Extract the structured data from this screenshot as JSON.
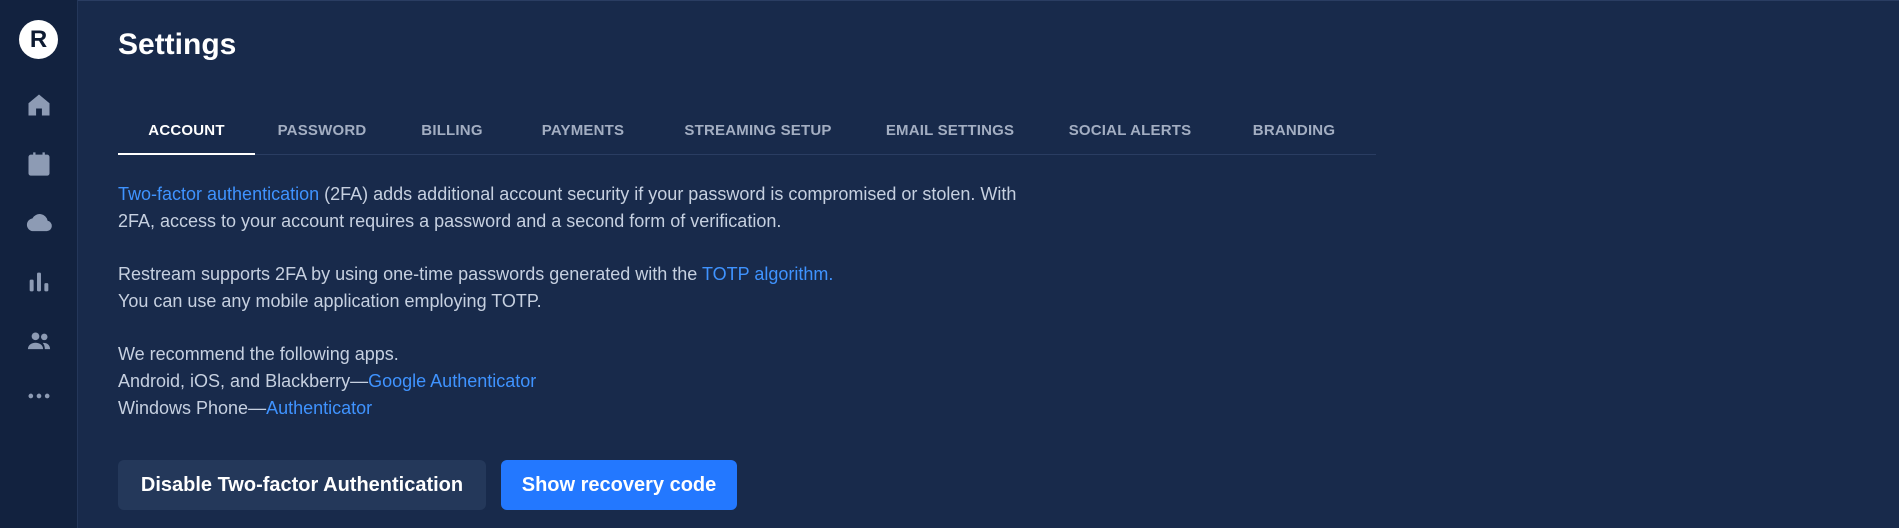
{
  "sidebar": {
    "logo_letter": "R",
    "items": [
      {
        "name": "home-icon"
      },
      {
        "name": "calendar-icon"
      },
      {
        "name": "cloud-icon"
      },
      {
        "name": "analytics-icon"
      },
      {
        "name": "team-icon"
      },
      {
        "name": "more-icon"
      }
    ]
  },
  "page": {
    "title": "Settings"
  },
  "tabs": [
    {
      "label": "ACCOUNT",
      "active": true
    },
    {
      "label": "PASSWORD",
      "active": false
    },
    {
      "label": "BILLING",
      "active": false
    },
    {
      "label": "PAYMENTS",
      "active": false
    },
    {
      "label": "STREAMING SETUP",
      "active": false
    },
    {
      "label": "EMAIL SETTINGS",
      "active": false
    },
    {
      "label": "SOCIAL ALERTS",
      "active": false
    },
    {
      "label": "BRANDING",
      "active": false
    }
  ],
  "content": {
    "p1_link": "Two-factor authentication",
    "p1_text": " (2FA) adds additional account security if your password is compromised or stolen. With",
    "p1_text2": "2FA, access to your account requires a password and a second form of verification.",
    "p2_text": "Restream supports 2FA by using one-time passwords generated with the ",
    "p2_link": "TOTP algorithm.",
    "p2_text2": "You can use any mobile application employing TOTP.",
    "p3_intro": "We recommend the following apps.",
    "p3_android_text": "Android, iOS, and Blackberry—",
    "p3_android_link": "Google Authenticator",
    "p3_windows_text": "Windows Phone—",
    "p3_windows_link": "Authenticator"
  },
  "actions": {
    "disable_label": "Disable Two-factor Authentication",
    "recovery_label": "Show recovery code"
  },
  "colors": {
    "background": "#182a4b",
    "sidebar": "#12223f",
    "link": "#3f93ff",
    "primary_button": "#2378ff",
    "secondary_button": "#24385a"
  }
}
